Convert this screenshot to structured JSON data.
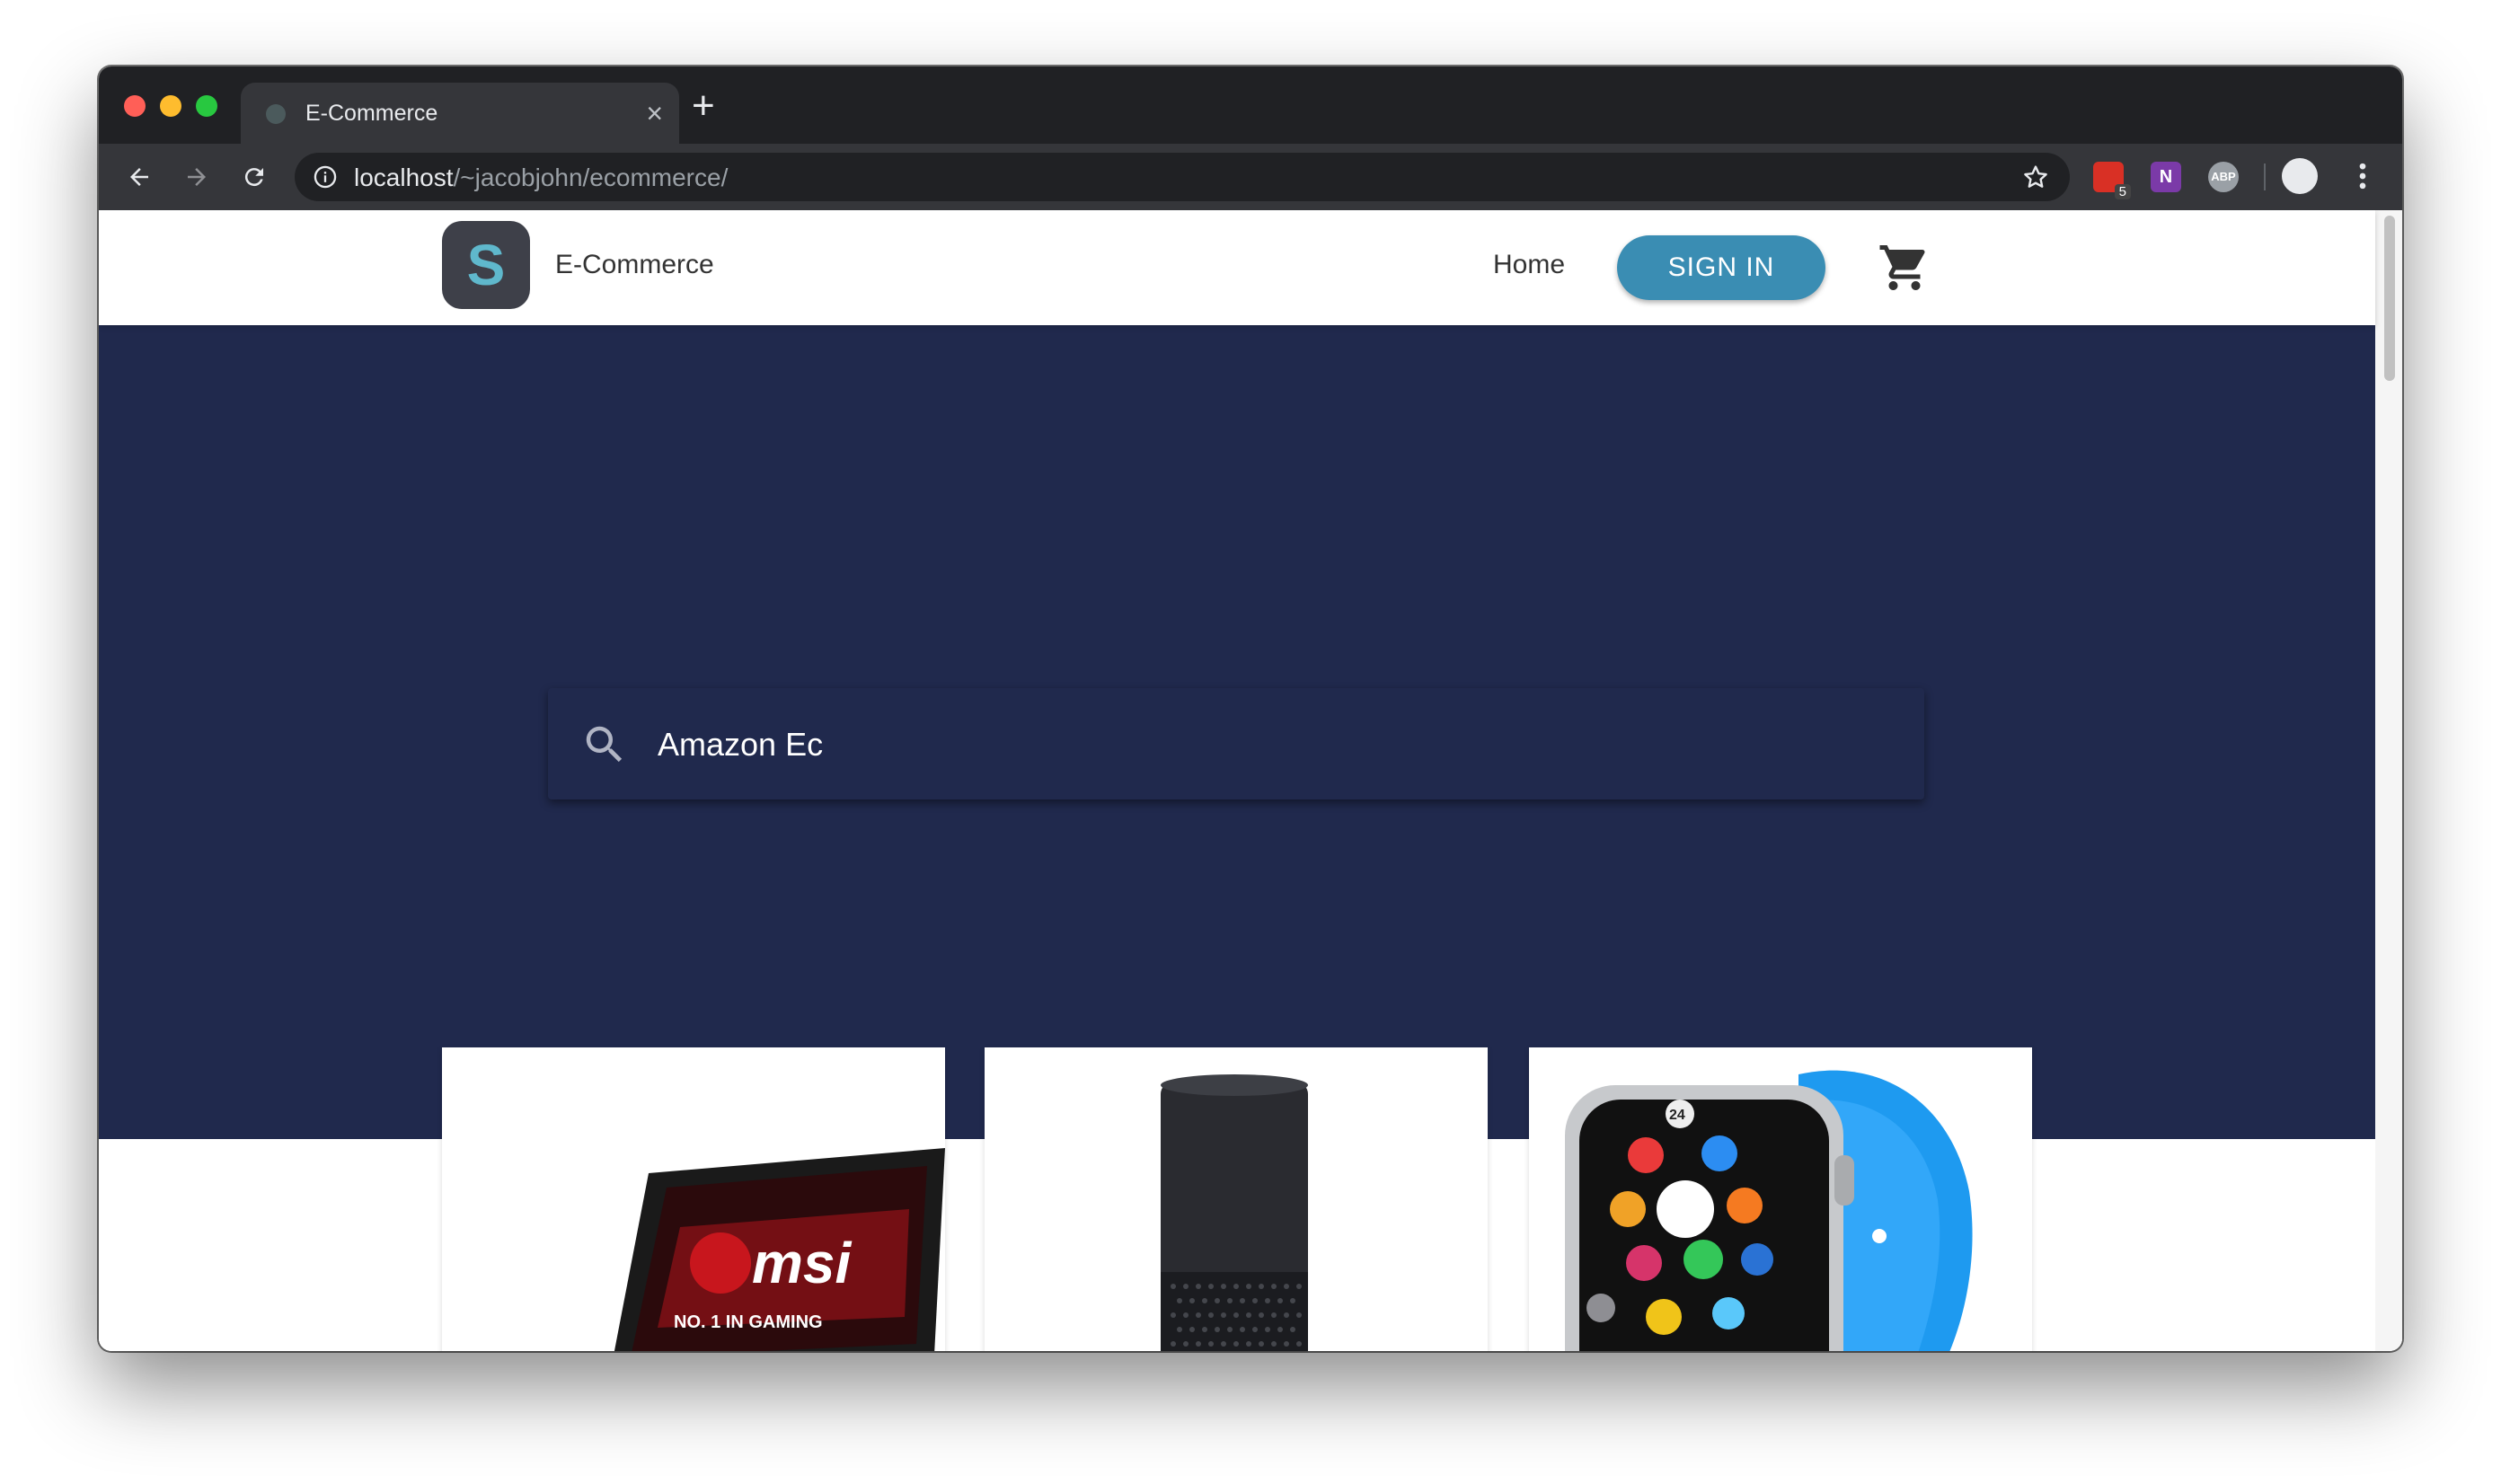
{
  "browser": {
    "tab_title": "E-Commerce",
    "url_host": "localhost",
    "url_path": "/~jacobjohn/ecommerce/",
    "extension_badge": "5",
    "extension_2_label": "N",
    "extension_3_label": "ABP"
  },
  "header": {
    "logo_letter": "S",
    "brand": "E-Commerce",
    "nav_home": "Home",
    "signin_label": "SIGN IN"
  },
  "search": {
    "value": "Amazon Ec"
  },
  "products": [
    {
      "name": "msi-laptop",
      "caption": "msi",
      "tagline": "NO. 1 IN GAMING"
    },
    {
      "name": "amazon-echo"
    },
    {
      "name": "apple-watch",
      "watch_face_number": "24"
    }
  ],
  "colors": {
    "hero": "#20294d",
    "signin": "#3a8db3",
    "logo_bg": "#3e4049",
    "logo_letter": "#5fb8cc"
  }
}
